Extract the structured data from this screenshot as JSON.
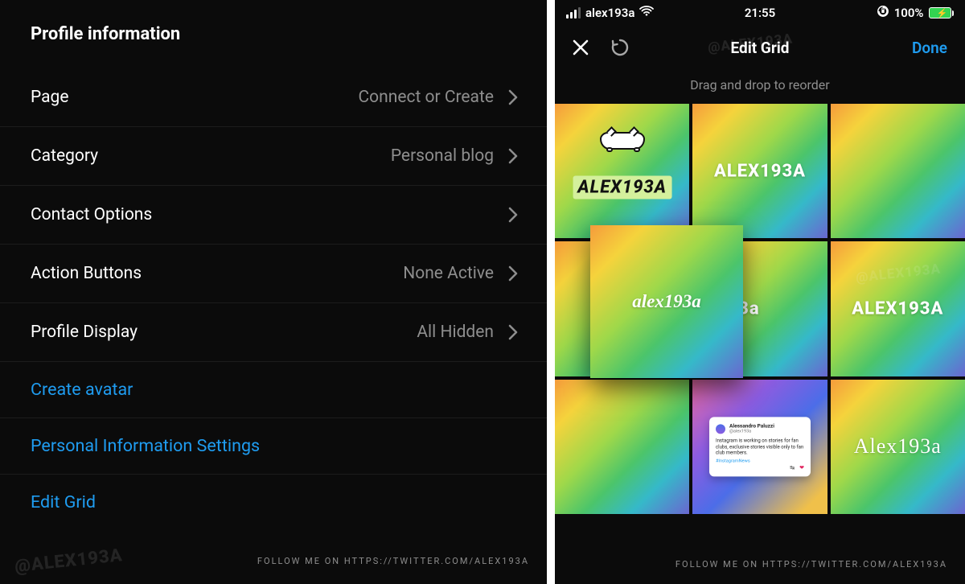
{
  "left": {
    "section_title": "Profile information",
    "rows": [
      {
        "label": "Page",
        "value": "Connect or Create"
      },
      {
        "label": "Category",
        "value": "Personal blog"
      },
      {
        "label": "Contact Options",
        "value": ""
      },
      {
        "label": "Action Buttons",
        "value": "None Active"
      },
      {
        "label": "Profile Display",
        "value": "All Hidden"
      }
    ],
    "links": {
      "create_avatar": "Create avatar",
      "personal_info": "Personal Information Settings",
      "edit_grid": "Edit Grid"
    },
    "watermark": "@ALEX193A",
    "footer": "FOLLOW ME ON HTTPS://TWITTER.COM/ALEX193A"
  },
  "right": {
    "status": {
      "carrier": "alex193a",
      "time": "21:55",
      "battery_pct": "100%",
      "rotation_lock": "↻"
    },
    "nav": {
      "title": "Edit Grid",
      "done": "Done"
    },
    "subtitle": "Drag and drop to reorder",
    "tiles": {
      "t1": "ALEX193A",
      "t2": "ALEX193A",
      "t3": "",
      "t4_drag": "alex193a",
      "t5": "x193a",
      "t6": "ALEX193A",
      "t7": "",
      "t8_card": {
        "name": "Alessandro Paluzzi",
        "handle": "@alex193a",
        "body": "Instagram is working on stories for fan clubs, exclusive stories visible only to fan club members.",
        "tag": "#InstagramNews"
      },
      "t9": "Alex193a",
      "t4_bg": ""
    },
    "watermark": "@ALEX193A",
    "footer": "FOLLOW ME ON HTTPS://TWITTER.COM/ALEX193A"
  },
  "colors": {
    "link_blue": "#1f9cf0",
    "text_secondary": "#8e8e8e",
    "bg": "#0b0b0b"
  }
}
